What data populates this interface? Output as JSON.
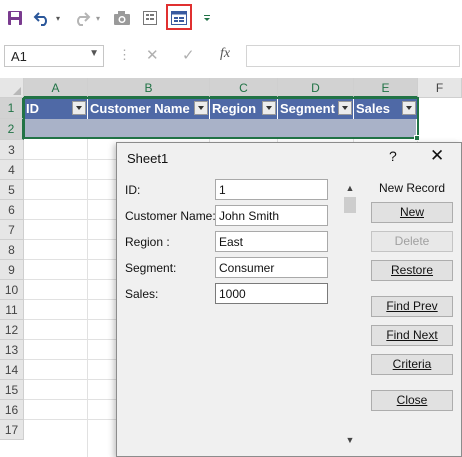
{
  "toolbar": {
    "items": [
      "save-icon",
      "undo-icon",
      "redo-icon",
      "camera-icon",
      "form-icon",
      "data-form-icon",
      "customize-icon"
    ],
    "highlight_color": "#e03030"
  },
  "formula_bar": {
    "name_box": "A1",
    "formula": ""
  },
  "sheet": {
    "columns": [
      "A",
      "B",
      "C",
      "D",
      "E",
      "F"
    ],
    "rows": [
      "1",
      "2",
      "3",
      "4",
      "5",
      "6",
      "7",
      "8",
      "9",
      "10",
      "11",
      "12",
      "13",
      "14",
      "15",
      "16",
      "17"
    ],
    "table_headers": [
      "ID",
      "Customer Name",
      "Region",
      "Segment",
      "Sales"
    ],
    "header_color": "#4f69a6",
    "selection_color": "#217346"
  },
  "dialog": {
    "title": "Sheet1",
    "help": "?",
    "close": "✕",
    "record_label": "New Record",
    "fields": [
      {
        "label": "ID:",
        "value": "1"
      },
      {
        "label": "Customer Name:",
        "value": "John Smith"
      },
      {
        "label": "Region :",
        "value": "East"
      },
      {
        "label": "Segment:",
        "value": "Consumer"
      },
      {
        "label": "Sales:",
        "value": "1000"
      }
    ],
    "buttons": {
      "new": "New",
      "delete": "Delete",
      "restore": "Restore",
      "find_prev": "Find Prev",
      "find_next": "Find Next",
      "criteria": "Criteria",
      "close": "Close"
    }
  }
}
